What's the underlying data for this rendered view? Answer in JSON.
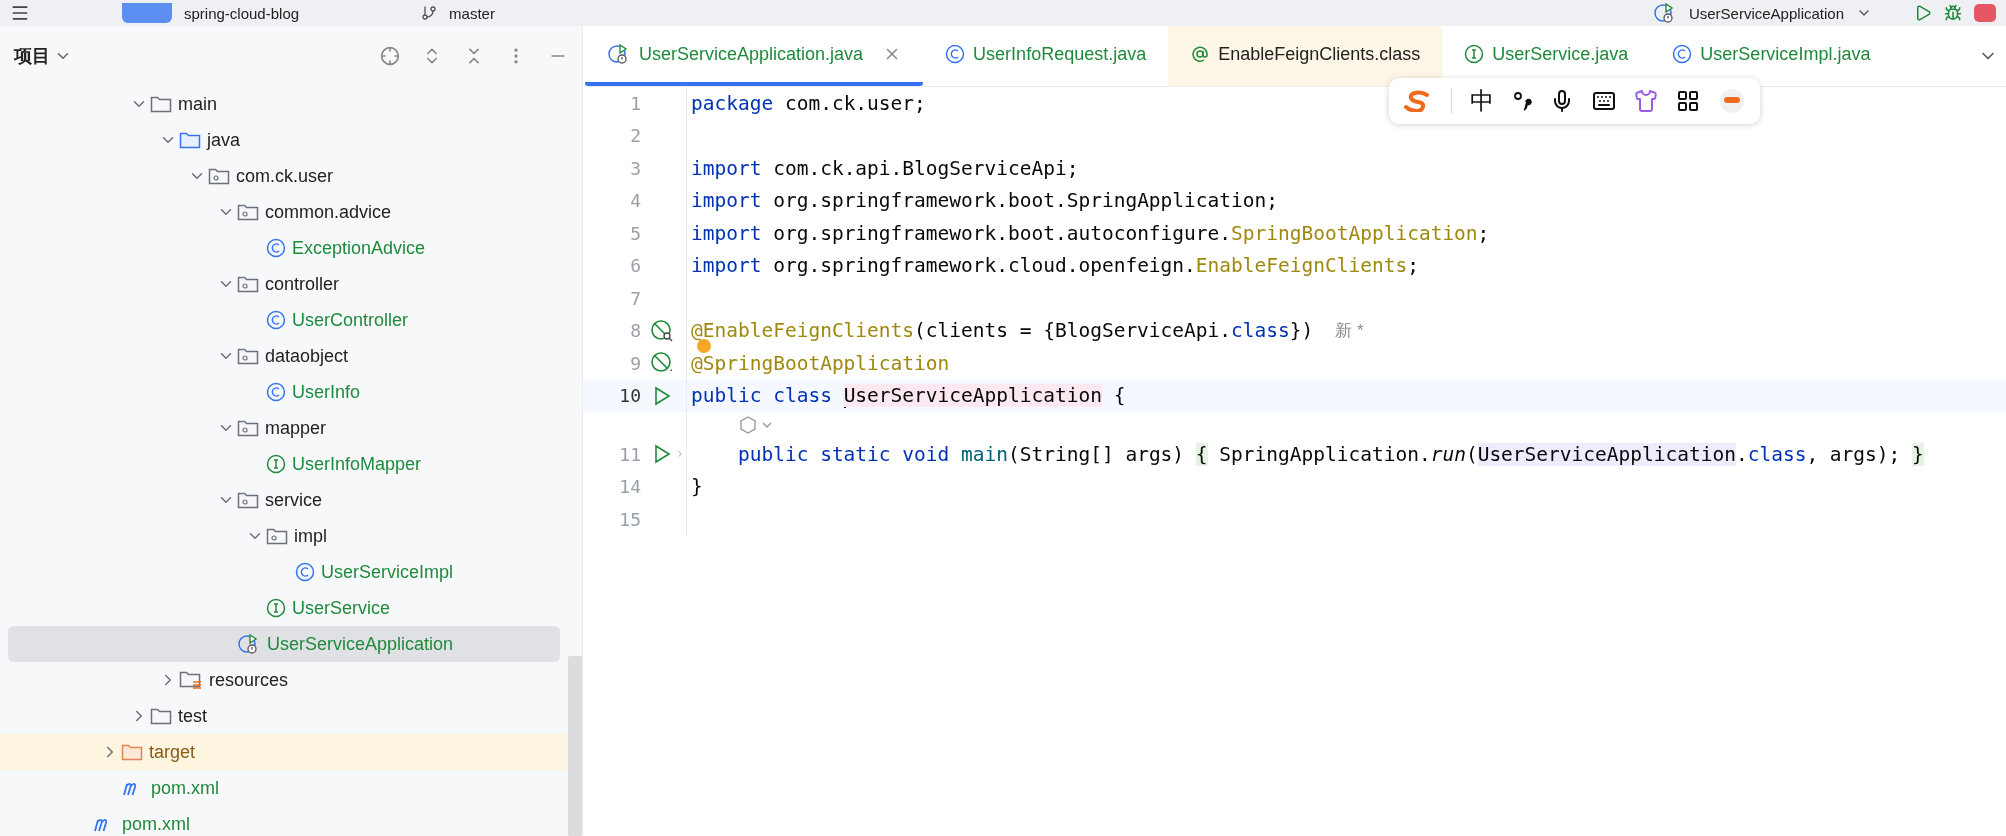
{
  "top_bar": {
    "project": "spring-cloud-blog",
    "branch": "master",
    "run_config": "UserServiceApplication"
  },
  "project_panel": {
    "title": "项目",
    "tree": [
      {
        "children": [
          {
            "children": [
              {
                "label": "main",
                "kind": "folder",
                "expanded": true,
                "selected": false,
                "added": false,
                "children": [
                  {
                    "label": "java",
                    "kind": "source-folder",
                    "expanded": true,
                    "selected": false,
                    "added": false,
                    "children": [
                      {
                        "label": "com.ck.user",
                        "kind": "package",
                        "expanded": true,
                        "selected": false,
                        "added": false,
                        "children": [
                          {
                            "label": "common.advice",
                            "kind": "package",
                            "expanded": true,
                            "selected": false,
                            "added": false,
                            "children": [
                              {
                                "label": "ExceptionAdvice",
                                "kind": "class",
                                "selected": false,
                                "added": true
                              }
                            ]
                          },
                          {
                            "label": "controller",
                            "kind": "package",
                            "expanded": true,
                            "selected": false,
                            "added": false,
                            "children": [
                              {
                                "label": "UserController",
                                "kind": "class",
                                "selected": false,
                                "added": true
                              }
                            ]
                          },
                          {
                            "label": "dataobject",
                            "kind": "package",
                            "expanded": true,
                            "selected": false,
                            "added": false,
                            "children": [
                              {
                                "label": "UserInfo",
                                "kind": "class",
                                "selected": false,
                                "added": true
                              }
                            ]
                          },
                          {
                            "label": "mapper",
                            "kind": "package",
                            "expanded": true,
                            "selected": false,
                            "added": false,
                            "children": [
                              {
                                "label": "UserInfoMapper",
                                "kind": "interface",
                                "selected": false,
                                "added": true
                              }
                            ]
                          },
                          {
                            "label": "service",
                            "kind": "package",
                            "expanded": true,
                            "selected": false,
                            "added": false,
                            "children": [
                              {
                                "label": "impl",
                                "kind": "package",
                                "expanded": true,
                                "selected": false,
                                "added": false,
                                "children": [
                                  {
                                    "label": "UserServiceImpl",
                                    "kind": "class",
                                    "selected": false,
                                    "added": true
                                  }
                                ]
                              },
                              {
                                "label": "UserService",
                                "kind": "interface",
                                "selected": false,
                                "added": true
                              }
                            ]
                          },
                          {
                            "label": "UserServiceApplication",
                            "kind": "app-class",
                            "selected": true,
                            "added": true
                          }
                        ]
                      }
                    ]
                  },
                  {
                    "label": "resources",
                    "kind": "resources-folder",
                    "expanded": false,
                    "selected": false,
                    "added": false
                  }
                ]
              },
              {
                "label": "test",
                "kind": "folder",
                "expanded": false,
                "selected": false,
                "added": false
              }
            ]
          },
          {
            "label": "target",
            "kind": "excluded-folder",
            "expanded": false,
            "selected": false,
            "added": false
          },
          {
            "label": "pom.xml",
            "kind": "maven",
            "selected": false,
            "added": true
          }
        ]
      },
      {
        "label": "pom.xml",
        "kind": "maven",
        "selected": false,
        "added": true
      }
    ]
  },
  "editor_tabs": [
    {
      "label": "UserServiceApplication.java",
      "kind": "app-class",
      "selected": true,
      "added": true,
      "read_only": false
    },
    {
      "label": "UserInfoRequest.java",
      "kind": "class",
      "selected": false,
      "added": true,
      "read_only": false
    },
    {
      "label": "EnableFeignClients.class",
      "kind": "annotation",
      "selected": false,
      "added": false,
      "read_only": true
    },
    {
      "label": "UserService.java",
      "kind": "interface",
      "selected": false,
      "added": true,
      "read_only": false
    },
    {
      "label": "UserServiceImpl.java",
      "kind": "class",
      "selected": false,
      "added": true,
      "read_only": false
    }
  ],
  "ime_toolbar": {
    "mode": "中"
  },
  "code": [
    {
      "number": "1",
      "current": false,
      "kind": "plain",
      "tokens": [
        {
          "kind": "keyword",
          "text": "package"
        },
        {
          "kind": "plain",
          "text": " com.ck.user;"
        }
      ]
    },
    {
      "number": "2",
      "current": false,
      "kind": "plain"
    },
    {
      "number": "3",
      "current": false,
      "kind": "plain",
      "tokens": [
        {
          "kind": "keyword",
          "text": "import"
        },
        {
          "kind": "plain",
          "text": " com.ck.api.BlogServiceApi;"
        }
      ]
    },
    {
      "number": "4",
      "current": false,
      "kind": "plain",
      "tokens": [
        {
          "kind": "keyword",
          "text": "import"
        },
        {
          "kind": "plain",
          "text": " org.springframework.boot.SpringApplication;"
        }
      ]
    },
    {
      "number": "5",
      "current": false,
      "kind": "plain",
      "tokens": [
        {
          "kind": "keyword",
          "text": "import"
        },
        {
          "kind": "plain",
          "text": " org.springframework.boot.autoconfigure."
        },
        {
          "kind": "annotation",
          "text": "SpringBootApplication"
        },
        {
          "kind": "plain",
          "text": ";"
        }
      ]
    },
    {
      "number": "6",
      "current": false,
      "kind": "plain",
      "tokens": [
        {
          "kind": "keyword",
          "text": "import"
        },
        {
          "kind": "plain",
          "text": " org.springframework.cloud.openfeign."
        },
        {
          "kind": "annotation",
          "text": "EnableFeignClients"
        },
        {
          "kind": "plain",
          "text": ";"
        }
      ]
    },
    {
      "number": "7",
      "current": false,
      "kind": "plain"
    },
    {
      "number": "8",
      "current": false,
      "kind": "bean",
      "hint": "新 *",
      "tokens": [
        {
          "kind": "annotation",
          "text": "@EnableFeignClients"
        },
        {
          "kind": "plain",
          "text": "(clients = {BlogServiceApi."
        },
        {
          "kind": "keyword",
          "text": "class"
        },
        {
          "kind": "plain",
          "text": "})"
        }
      ]
    },
    {
      "number": "9",
      "current": false,
      "kind": "bean-off",
      "tokens": [
        {
          "kind": "annotation",
          "text": "@SpringBootApplication"
        }
      ]
    },
    {
      "number": "10",
      "current": true,
      "kind": "run",
      "tokens": [
        {
          "kind": "keyword",
          "text": "public class "
        },
        {
          "kind": "usage",
          "text": "UserServiceApplication"
        },
        {
          "kind": "plain",
          "text": " {"
        }
      ]
    },
    {
      "number": "11",
      "current": false,
      "kind": "run",
      "folded": true,
      "tokens": [
        {
          "kind": "keyword",
          "text": "    public static void "
        },
        {
          "kind": "method",
          "text": "main"
        },
        {
          "kind": "plain",
          "text": "(String[] args) "
        },
        {
          "kind": "fold",
          "text": "{"
        },
        {
          "kind": "plain",
          "text": " SpringApplication."
        },
        {
          "kind": "static-call",
          "text": "run"
        },
        {
          "kind": "plain",
          "text": "("
        },
        {
          "kind": "reference",
          "text": "UserServiceApplication"
        },
        {
          "kind": "plain",
          "text": "."
        },
        {
          "kind": "keyword",
          "text": "class"
        },
        {
          "kind": "plain",
          "text": ", args); "
        },
        {
          "kind": "fold",
          "text": "}"
        }
      ]
    },
    {
      "number": "14",
      "current": false,
      "kind": "plain",
      "tokens": [
        {
          "kind": "plain",
          "text": "}"
        }
      ]
    },
    {
      "number": "15",
      "current": false,
      "kind": "plain"
    }
  ]
}
